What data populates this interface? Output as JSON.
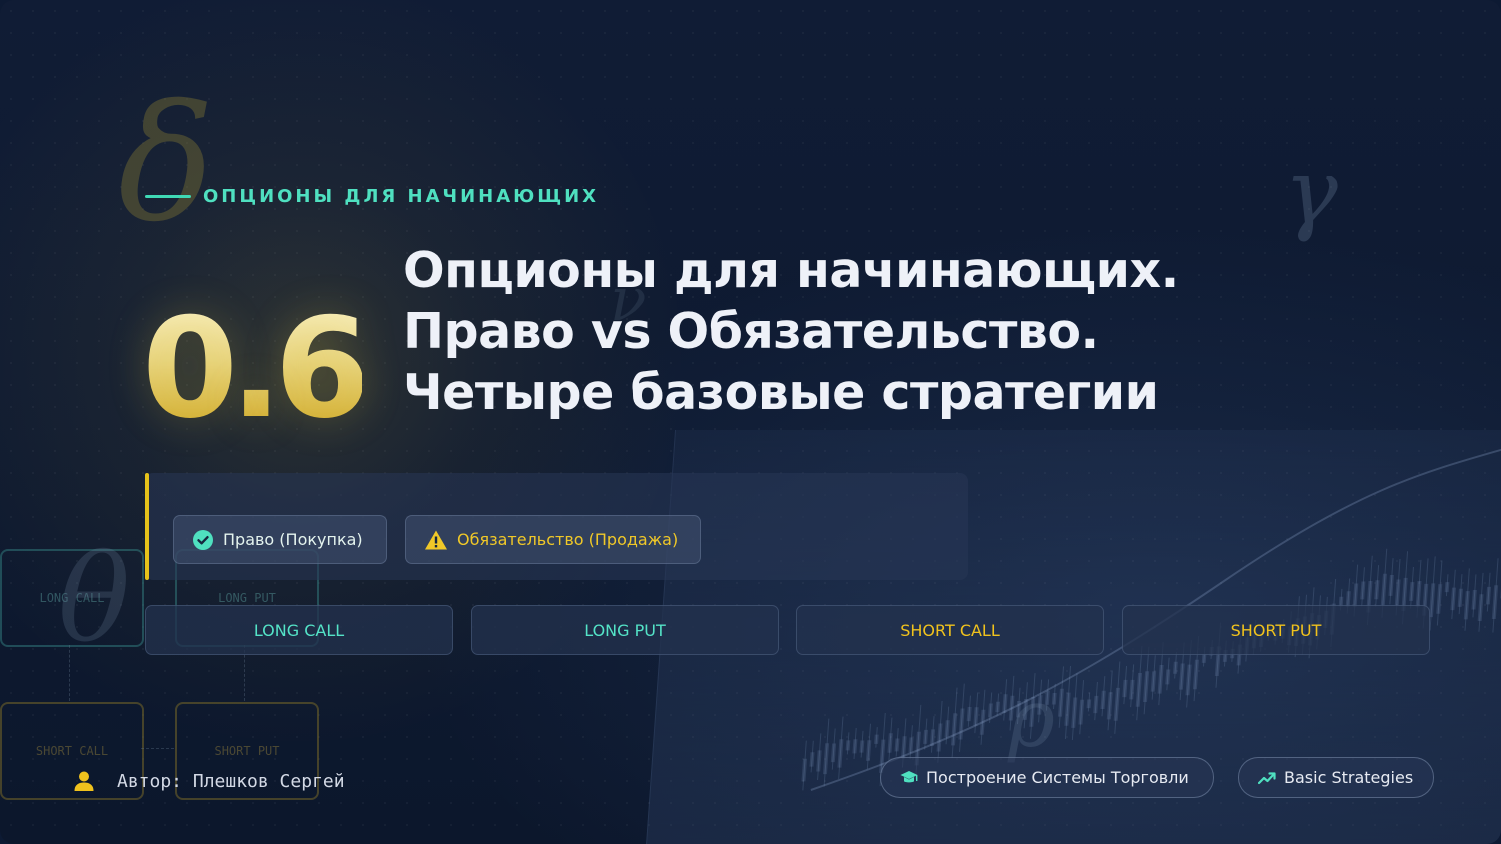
{
  "kicker": "ОПЦИОНЫ ДЛЯ НАЧИНАЮЩИХ",
  "number": "0.6",
  "title_lines": [
    "Опционы для начинающих.",
    "Право vs Обязательство.",
    "Четыре базовые стратегии"
  ],
  "legend": {
    "right_label": "Право (Покупка)",
    "right_icon": "check-circle-icon",
    "obligation_label": "Обязательство (Продажа)",
    "obligation_icon": "warning-icon"
  },
  "strategies": [
    "LONG CALL",
    "LONG PUT",
    "SHORT CALL",
    "SHORT PUT"
  ],
  "diagram_labels": [
    "LONG CALL",
    "LONG PUT",
    "SHORT CALL",
    "SHORT PUT"
  ],
  "greek_symbols": {
    "delta": "δ",
    "gamma": "γ",
    "nu": "ν",
    "theta": "θ",
    "rho": "ρ"
  },
  "author": "Автор: Плешков Сергей",
  "tags": [
    {
      "label": "Построение Системы Торговли",
      "icon": "graduation-cap-icon"
    },
    {
      "label": "Basic Strategies",
      "icon": "trend-up-icon"
    }
  ],
  "colors": {
    "background": "#0e1a31",
    "teal_accent": "#54e3c7",
    "gold_accent": "#f0c21d",
    "title_text": "#eef1f8"
  }
}
